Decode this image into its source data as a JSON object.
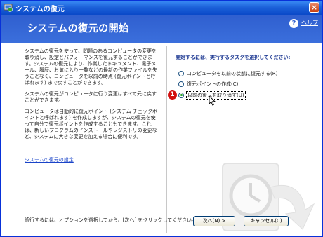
{
  "window": {
    "title": "システムの復元",
    "close_label": "×"
  },
  "banner": {
    "title": "システムの復元の開始",
    "help_label": "ヘルプ",
    "help_icon": "?"
  },
  "left": {
    "paragraphs": [
      "システムの復元を使って、問題のあるコンピュータの変更を取り消し、設定とパフォーマンスを復元することができます。システムの復元により、作業したドキュメント、電子メール、履歴、お気に入り一覧などの最新の作業ファイルを失うことなく、コンピュータを以前の時点 (復元ポイントと呼ばれます) まで戻すことができます。",
      "システムの復元がコンピュータに行う変更はすべて元に戻すことができます。",
      "コンピュータは自動的に復元ポイント (システム チェックポイントと呼ばれます) を作成しますが、システムの復元を使って自分で復元ポイントを作成することもできます。これは、新しいプログラムのインストールやレジストリの変更など、システムに大きな変更を加える場合に便利です。"
    ],
    "settings_link": "システムの復元の設定"
  },
  "right": {
    "heading": "開始するには、実行するタスクを選択してください:",
    "options": [
      {
        "label": "コンピュータを以前の状態に復元する(R)",
        "checked": false
      },
      {
        "label": "復元ポイントの作成(C)",
        "checked": false
      },
      {
        "label": "以前の復元を取り消す(U)",
        "checked": true
      }
    ],
    "marker": "1"
  },
  "footer": {
    "instruction": "続行するには、オプションを選択してから、[次へ] をクリックしてください。",
    "next_label": "次へ(N) >",
    "cancel_label": "キャンセル(C)"
  },
  "colors": {
    "accent": "#2f5fcf",
    "marker": "#d21010",
    "link": "#1a44c8"
  }
}
